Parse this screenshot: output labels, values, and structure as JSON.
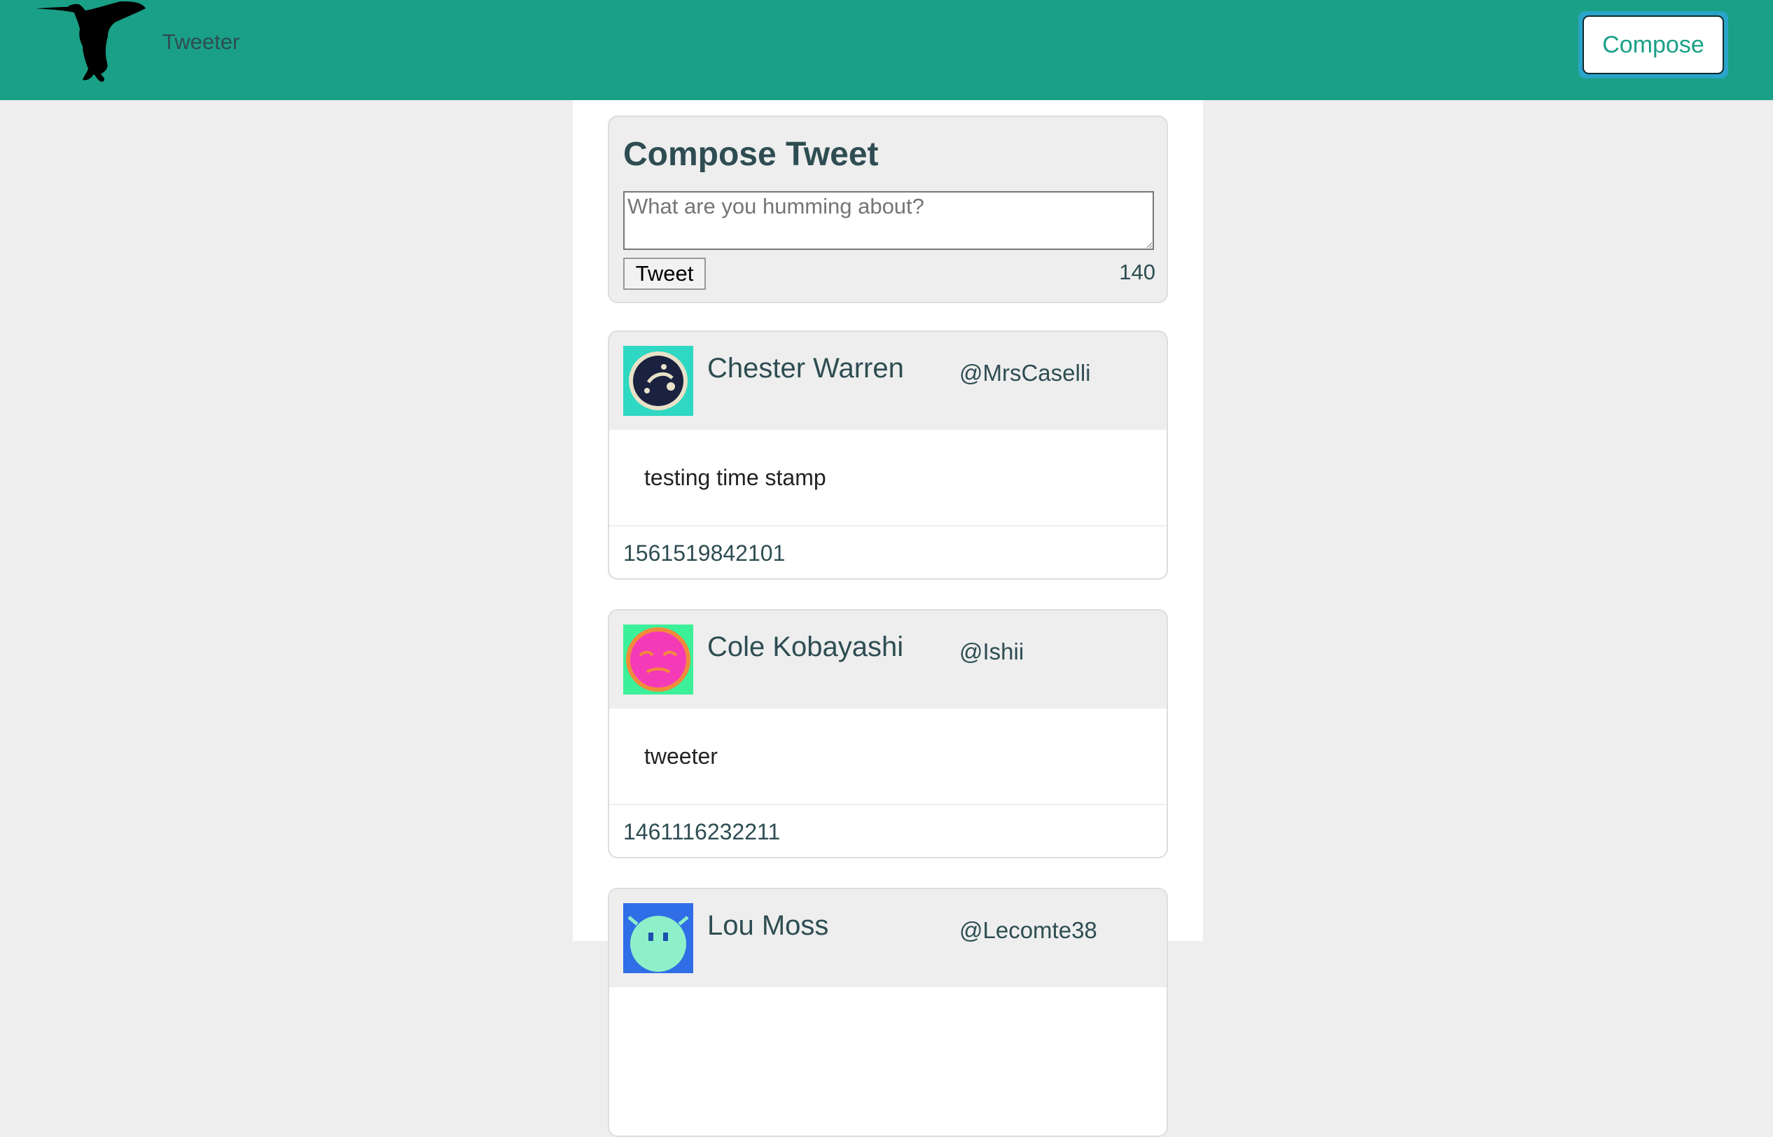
{
  "colors": {
    "nav_bg": "#1aa087",
    "accent_text": "#1aa087",
    "dark_text": "#2e4d52",
    "page_bg": "#eeeeee",
    "focus_ring": "#2aa4c9"
  },
  "nav": {
    "logo_icon": "hummingbird-icon",
    "brand": "Tweeter",
    "compose_label": "Compose"
  },
  "compose": {
    "title": "Compose Tweet",
    "placeholder": "What are you humming about?",
    "button_label": "Tweet",
    "counter": "140"
  },
  "tweets": [
    {
      "name": "Chester Warren",
      "handle": "@MrsCaselli",
      "text": "testing time stamp",
      "timestamp": "1561519842101",
      "avatar_bg": "#2ed8c2",
      "avatar_fg": "#1b2240"
    },
    {
      "name": "Cole Kobayashi",
      "handle": "@Ishii",
      "text": "tweeter",
      "timestamp": "1461116232211",
      "avatar_bg": "#3cf09a",
      "avatar_fg": "#f53ab8"
    },
    {
      "name": "Lou Moss",
      "handle": "@Lecomte38",
      "text": "",
      "timestamp": "",
      "avatar_bg": "#2f6ee6",
      "avatar_fg": "#8ef0c8"
    }
  ]
}
